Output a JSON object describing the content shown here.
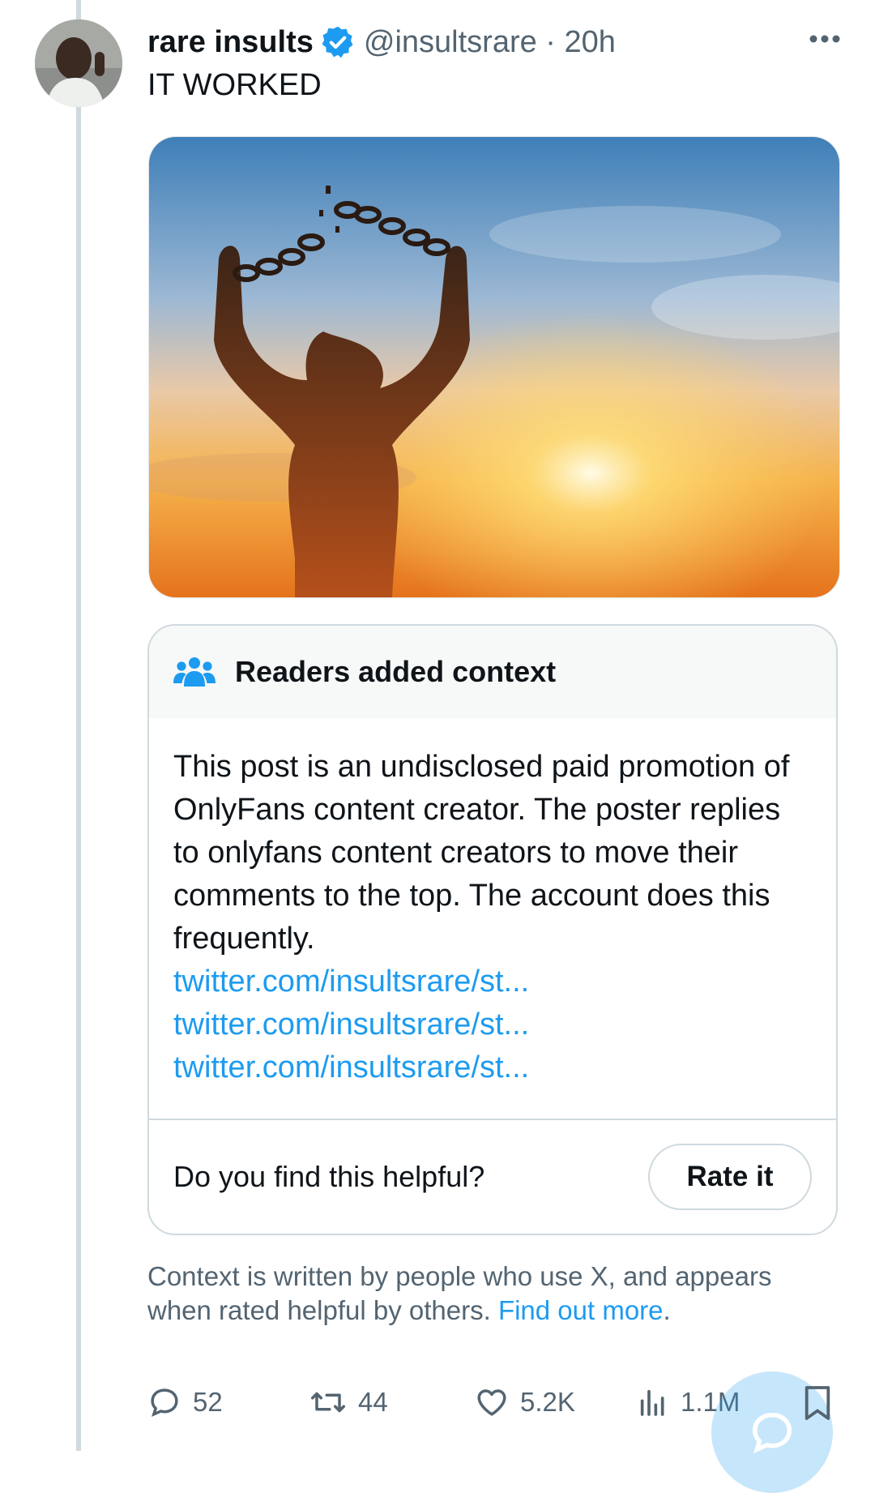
{
  "tweet": {
    "author_name": "rare insults",
    "handle_time": "@insultsrare · 20h",
    "text": "IT WORKED"
  },
  "note": {
    "title": "Readers added context",
    "body": "This post is an undisclosed paid promotion of OnlyFans content creator. The poster replies to onlyfans content creators to move their comments to the top. The account does this frequently.",
    "links": [
      "twitter.com/insultsrare/st...",
      "twitter.com/insultsrare/st...",
      "twitter.com/insultsrare/st..."
    ],
    "question": "Do you find this helpful?",
    "rate_label": "Rate it"
  },
  "disclaimer": {
    "text": "Context is written by people who use X, and appears when rated helpful by others.",
    "link": "Find out more",
    "suffix": "."
  },
  "actions": {
    "replies": "52",
    "reposts": "44",
    "likes": "5.2K",
    "views": "1.1M"
  },
  "icons": {
    "verified": "verified-badge-icon",
    "more": "more-icon",
    "people": "people-icon",
    "reply": "reply-icon",
    "repost": "repost-icon",
    "like": "heart-icon",
    "views": "views-icon",
    "bookmark": "bookmark-icon",
    "compose": "compose-icon"
  },
  "colors": {
    "accent": "#1d9bf0",
    "muted": "#536471",
    "border": "#cfd9de"
  }
}
